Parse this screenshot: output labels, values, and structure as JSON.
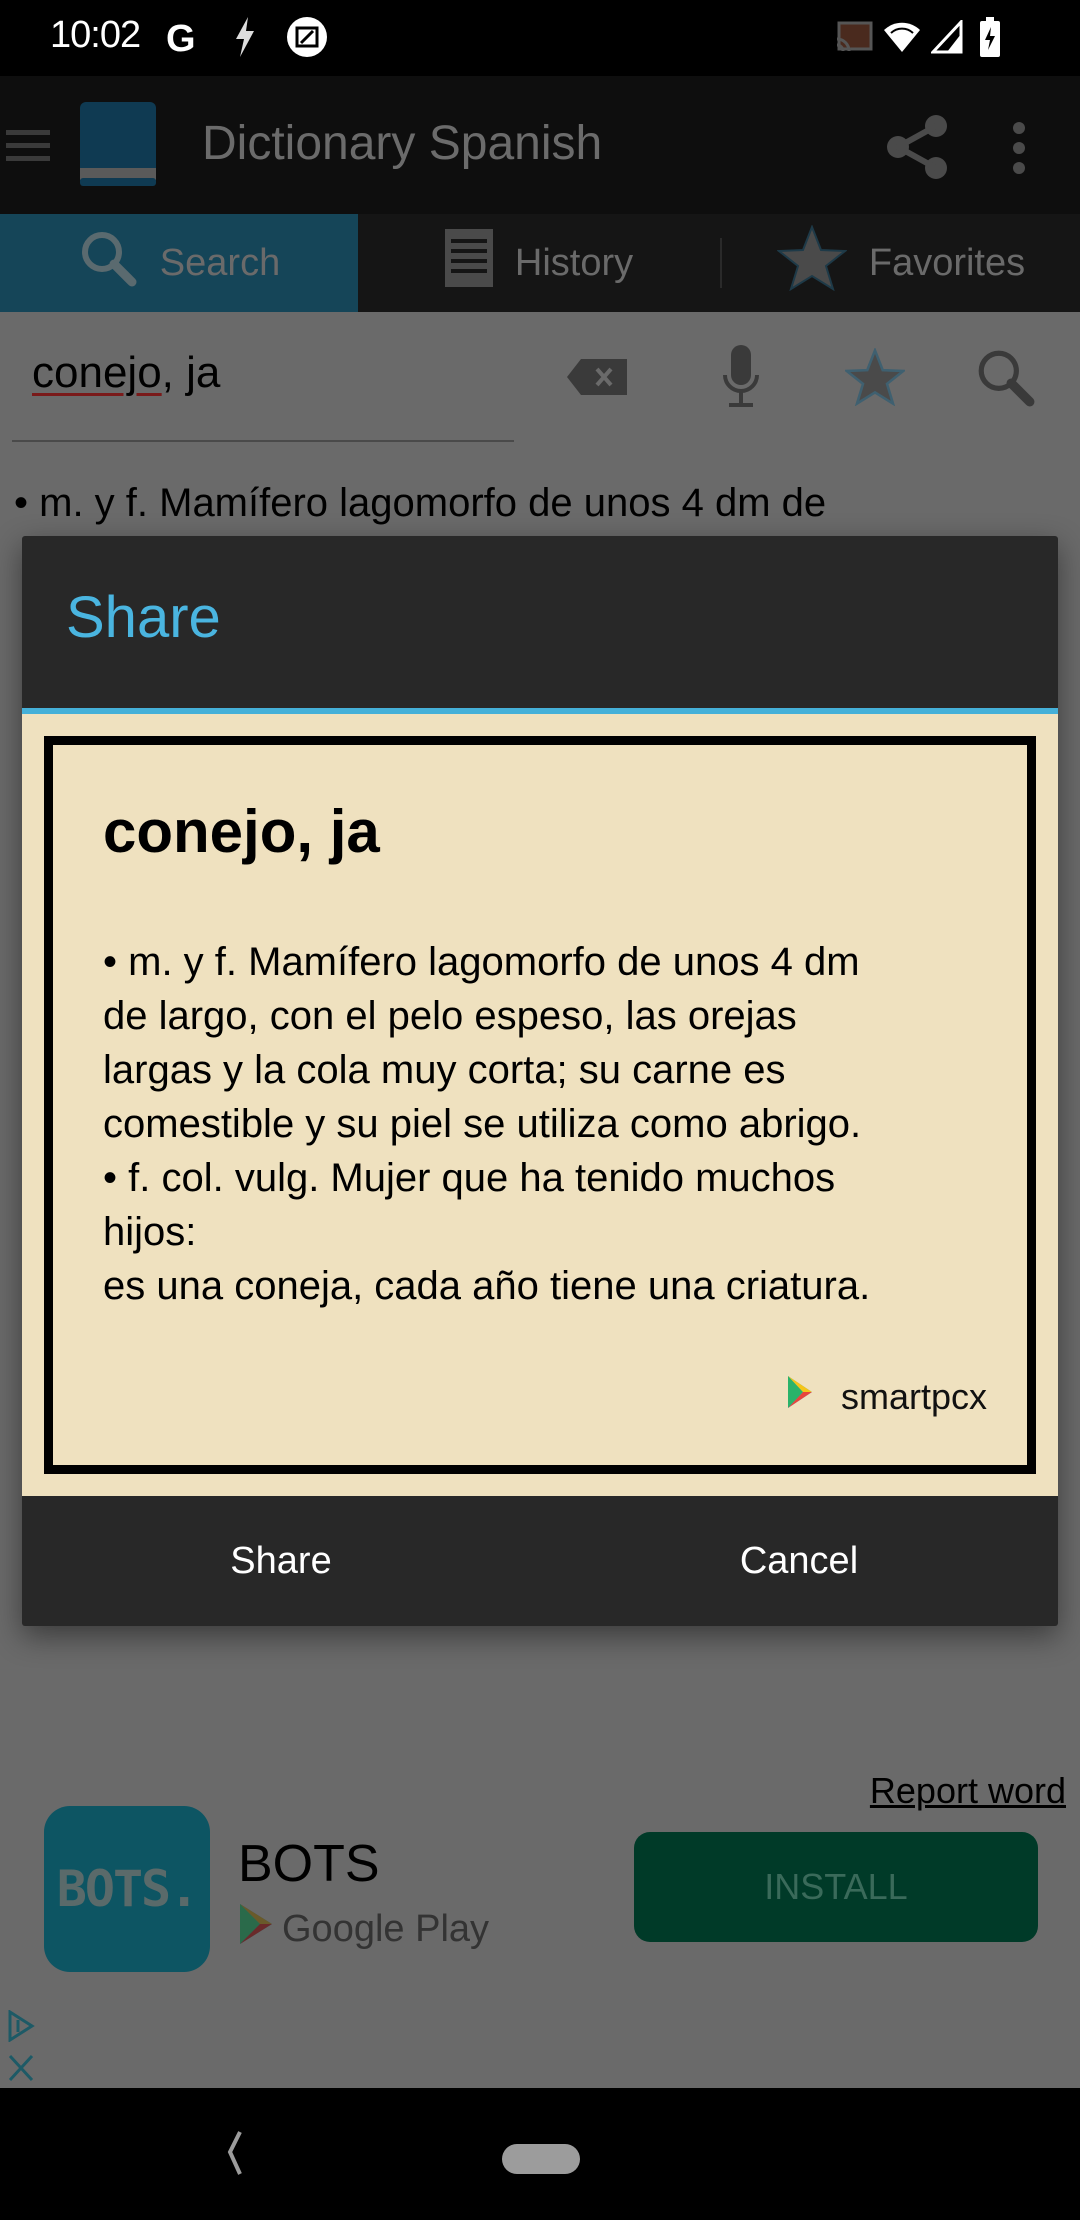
{
  "status_bar": {
    "time": "10:02",
    "left_icons": [
      "google-icon",
      "flash-icon",
      "screenshot-edit-icon"
    ],
    "right_icons": [
      "cast-icon",
      "wifi-icon",
      "cell-signal-icon",
      "battery-charging-icon"
    ]
  },
  "app": {
    "title": "Dictionary Spanish",
    "tabs": [
      {
        "label": "Search",
        "icon": "search-icon",
        "active": true
      },
      {
        "label": "History",
        "icon": "history-list-icon",
        "active": false
      },
      {
        "label": "Favorites",
        "icon": "star-icon",
        "active": false
      }
    ],
    "search": {
      "value_misspelled_part": "conejo",
      "value_rest": ", ja"
    },
    "definition_preview": "•  m. y f. Mamífero lagomorfo de unos 4 dm de",
    "report_word_label": "Report word"
  },
  "ad": {
    "app_icon_text": "BOTS.",
    "app_name": "BOTS",
    "store": "Google Play",
    "install_label": "INSTALL"
  },
  "dialog": {
    "title": "Share",
    "card": {
      "word": "conejo, ja",
      "definition_lines": [
        "•   m. y f. Mamífero lagomorfo de unos 4 dm",
        "de largo, con el pelo espeso, las orejas",
        "largas y la cola muy corta; su carne es",
        "comestible y su piel se utiliza como abrigo.",
        "•    f. col. vulg. Mujer que ha tenido muchos",
        "hijos:",
        "es una coneja, cada año tiene una criatura."
      ],
      "brand": "smartpcx"
    },
    "share_label": "Share",
    "cancel_label": "Cancel"
  },
  "colors": {
    "accent": "#4ab5e0",
    "card_bg": "#efe1bf",
    "dialog_bg": "#282828",
    "install_bg": "#003a28"
  }
}
